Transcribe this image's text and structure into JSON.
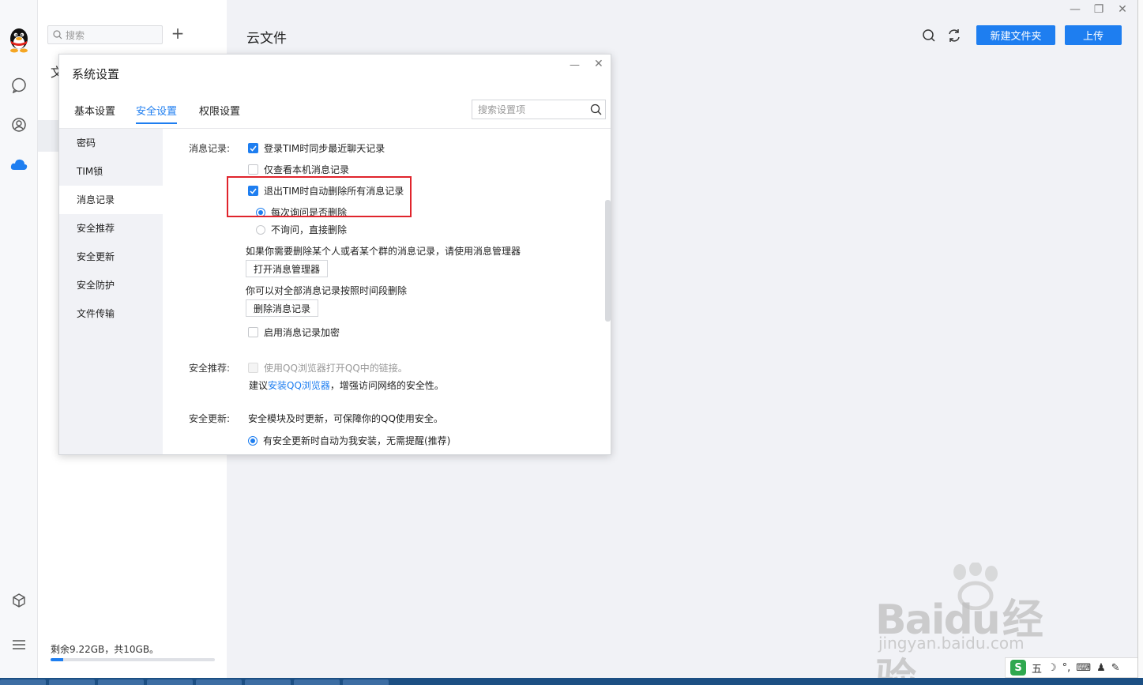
{
  "sidebar": {
    "search_placeholder": "搜索",
    "add_label": "+",
    "doc_initial": "文",
    "storage_text": "剩余9.22GB，共10GB。",
    "storage_used_fraction": 0.078,
    "icons": [
      "qq-penguin-icon",
      "chat-icon",
      "contacts-icon",
      "cloud-icon",
      "cube-icon",
      "menu-icon"
    ]
  },
  "main": {
    "title": "云文件",
    "new_folder_label": "新建文件夹",
    "upload_label": "上传",
    "accent": "#1e7ef0"
  },
  "dialog": {
    "title": "系统设置",
    "tabs": [
      {
        "label": "基本设置"
      },
      {
        "label": "安全设置"
      },
      {
        "label": "权限设置"
      }
    ],
    "active_tab": "安全设置",
    "search_placeholder": "搜索设置项",
    "side_items": [
      {
        "label": "密码"
      },
      {
        "label": "TIM锁"
      },
      {
        "label": "消息记录"
      },
      {
        "label": "安全推荐"
      },
      {
        "label": "安全更新"
      },
      {
        "label": "安全防护"
      },
      {
        "label": "文件传输"
      }
    ],
    "active_side_item": "消息记录",
    "message_record": {
      "label": "消息记录:",
      "sync_label": "登录TIM时同步最近聊天记录",
      "sync_checked": true,
      "local_only_label": "仅查看本机消息记录",
      "local_only_checked": false,
      "auto_delete_label": "退出TIM时自动删除所有消息记录",
      "auto_delete_checked": true,
      "ask_each_time_label": "每次询问是否删除",
      "ask_each_time_selected": true,
      "no_ask_label": "不询问，直接删除",
      "no_ask_selected": false,
      "manager_hint": "如果你需要删除某个人或者某个群的消息记录，请使用消息管理器",
      "open_manager_button": "打开消息管理器",
      "delete_by_time_hint": "你可以对全部消息记录按照时间段删除",
      "delete_records_button": "删除消息记录",
      "encrypt_label": "启用消息记录加密",
      "encrypt_checked": false
    },
    "security_recommend": {
      "label": "安全推荐:",
      "browser_link_label": "使用QQ浏览器打开QQ中的链接。",
      "browser_link_checked": false,
      "suggest_prefix": "建议",
      "suggest_link": "安装QQ浏览器",
      "suggest_suffix": "，增强访问网络的安全性。"
    },
    "security_update": {
      "label": "安全更新:",
      "desc": "安全模块及时更新，可保障你的QQ使用安全。",
      "auto_install_label": "有安全更新时自动为我安装，无需提醒(推荐)",
      "auto_install_selected": true
    }
  },
  "watermark": {
    "brand": "Bai",
    "brand2": "du",
    "brand_cn": "经验",
    "url": "jingyan.baidu.com"
  },
  "tray": {
    "ime_label": "五"
  }
}
